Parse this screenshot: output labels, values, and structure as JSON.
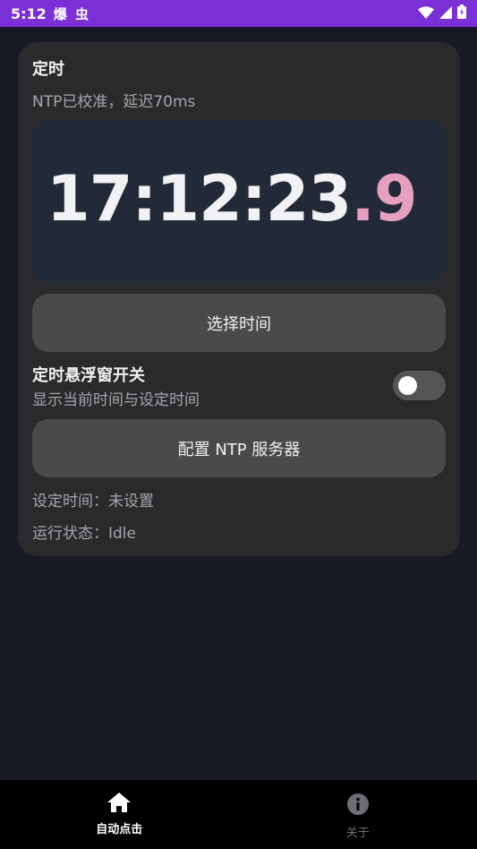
{
  "status_bar": {
    "time": "5:12",
    "notifications": "爆 虫",
    "bg_color": "#7b2fd6"
  },
  "timer_card": {
    "title": "定时",
    "ntp_status": "NTP已校准，延迟70ms",
    "clock": {
      "main": "17:12:23",
      "separator": ".",
      "fraction": "9",
      "fraction_color": "#e6a0bf"
    },
    "select_time_button": "选择时间",
    "floating_window": {
      "title": "定时悬浮窗开关",
      "subtitle": "显示当前时间与设定时间",
      "enabled": false
    },
    "ntp_config_button": "配置 NTP 服务器",
    "set_time_line": "设定时间：未设置",
    "run_status_line": "运行状态：Idle"
  },
  "bottom_nav": {
    "items": [
      {
        "label": "自动点击",
        "icon": "home-icon",
        "active": true
      },
      {
        "label": "关于",
        "icon": "info-icon",
        "active": false
      }
    ]
  }
}
